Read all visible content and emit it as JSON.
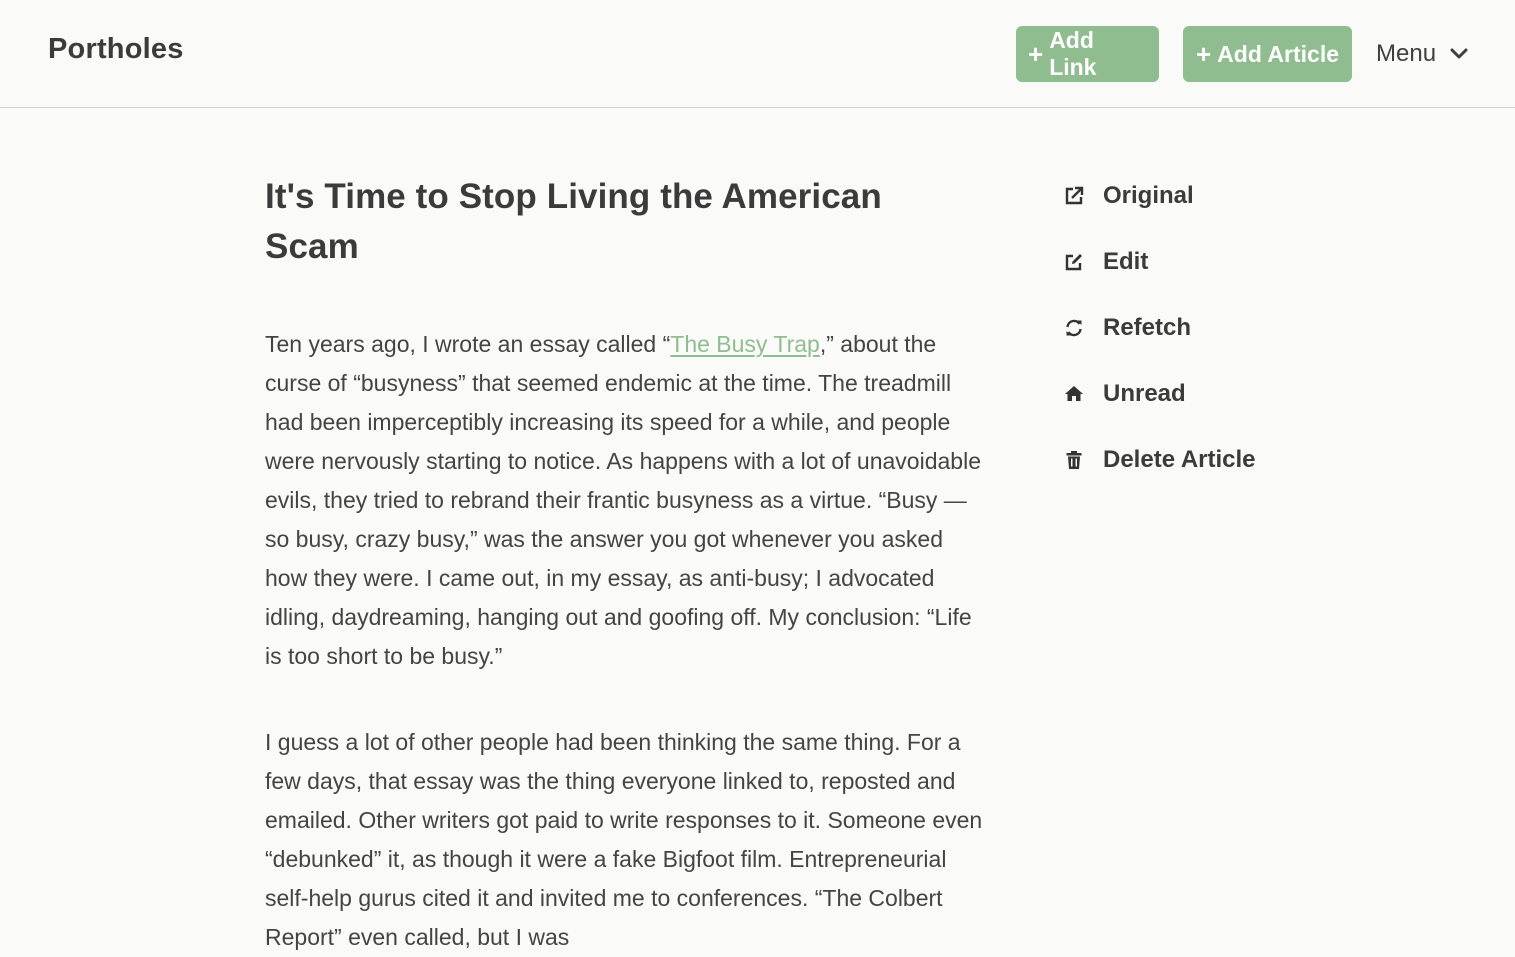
{
  "header": {
    "brand": "Portholes",
    "add_link_label": "Add Link",
    "add_article_label": "Add Article",
    "plus_symbol": "+",
    "menu_label": "Menu"
  },
  "article": {
    "title": "It's Time to Stop Living the American Scam",
    "paragraph1": {
      "before_link": "Ten years ago, I wrote an essay called “",
      "link_text": "The Busy Trap",
      "after_link": ",” about the curse of “busyness” that seemed endemic at the time. The treadmill had been imperceptibly increasing its speed for a while, and people were nervously starting to notice. As happens with a lot of unavoidable evils, they tried to rebrand their frantic busyness as a virtue. “Busy — so busy, crazy busy,” was the answer you got whenever you asked how they were. I came out, in my essay, as anti-busy; I advocated idling, daydreaming, hanging out and goofing off. My conclusion: “Life is too short to be busy.”"
    },
    "paragraph2": "I guess a lot of other people had been thinking the same thing. For a few days, that essay was the thing everyone linked to, reposted and emailed. Other writers got paid to write responses to it. Someone even “debunked” it, as though it were a fake Bigfoot film. Entrepreneurial self-help gurus cited it and invited me to conferences. “The Colbert Report” even called, but I was"
  },
  "sidebar": {
    "items": [
      {
        "label": "Original",
        "icon": "external-link-icon"
      },
      {
        "label": "Edit",
        "icon": "edit-icon"
      },
      {
        "label": "Refetch",
        "icon": "refresh-icon"
      },
      {
        "label": "Unread",
        "icon": "home-icon"
      },
      {
        "label": "Delete Article",
        "icon": "trash-icon"
      }
    ]
  },
  "colors": {
    "accent": "#8fbd8f",
    "background": "#fafaf9",
    "text": "#3f3f3f"
  }
}
